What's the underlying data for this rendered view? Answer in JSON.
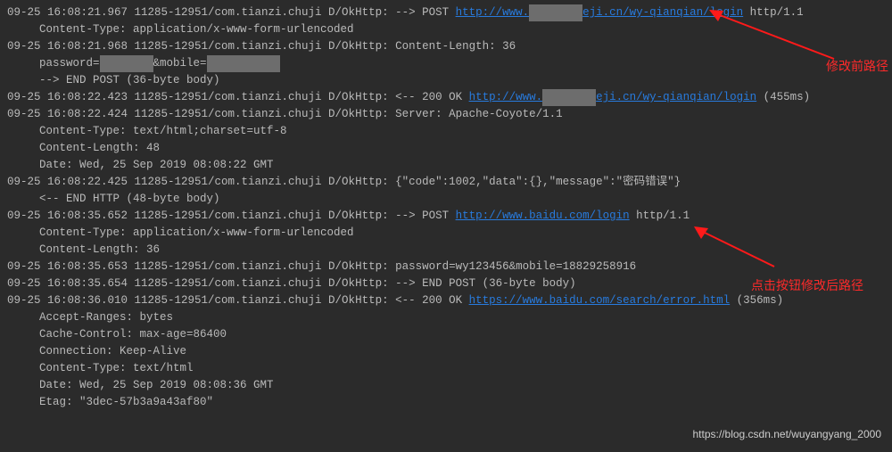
{
  "log": {
    "l1_ts": "09-25 16:08:21.967 11285-12951/com.tianzi.chuji D/OkHttp: --> POST ",
    "l1_url_a": "http://www.",
    "l1_url_mask": "________",
    "l1_url_b": "eji.cn/wy-qianqian/login",
    "l1_tail": " http/1.1",
    "l2": "Content-Type: application/x-www-form-urlencoded",
    "l3": "09-25 16:08:21.968 11285-12951/com.tianzi.chuji D/OkHttp: Content-Length: 36",
    "l4_a": "password=",
    "l4_mask1": "________",
    "l4_b": "&mobile=",
    "l4_mask2": "___________",
    "l5": "--> END POST (36-byte body)",
    "l6_ts": "09-25 16:08:22.423 11285-12951/com.tianzi.chuji D/OkHttp: <-- 200 OK ",
    "l6_url_a": "http://www.",
    "l6_mask": "________",
    "l6_url_b": "eji.cn/wy-qianqian/login",
    "l6_tail": " (455ms)",
    "l7": "09-25 16:08:22.424 11285-12951/com.tianzi.chuji D/OkHttp: Server: Apache-Coyote/1.1",
    "l8": "Content-Type: text/html;charset=utf-8",
    "l9": "Content-Length: 48",
    "l10": "Date: Wed, 25 Sep 2019 08:08:22 GMT",
    "l11": "09-25 16:08:22.425 11285-12951/com.tianzi.chuji D/OkHttp: {\"code\":1002,\"data\":{},\"message\":\"密码错误\"}",
    "l12": "<-- END HTTP (48-byte body)",
    "l13_ts": "09-25 16:08:35.652 11285-12951/com.tianzi.chuji D/OkHttp: --> POST ",
    "l13_url": "http://www.baidu.com/login",
    "l13_tail": " http/1.1",
    "l14": "Content-Type: application/x-www-form-urlencoded",
    "l15": "Content-Length: 36",
    "l16": "09-25 16:08:35.653 11285-12951/com.tianzi.chuji D/OkHttp: password=wy123456&mobile=18829258916",
    "l17": "09-25 16:08:35.654 11285-12951/com.tianzi.chuji D/OkHttp: --> END POST (36-byte body)",
    "l18_ts": "09-25 16:08:36.010 11285-12951/com.tianzi.chuji D/OkHttp: <-- 200 OK ",
    "l18_url": "https://www.baidu.com/search/error.html",
    "l18_tail": " (356ms)",
    "l19": "Accept-Ranges: bytes",
    "l20": "Cache-Control: max-age=86400",
    "l21": "Connection: Keep-Alive",
    "l22": "Content-Type: text/html",
    "l23": "Date: Wed, 25 Sep 2019 08:08:36 GMT",
    "l24": "Etag: \"3dec-57b3a9a43af80\""
  },
  "annot": {
    "top": "修改前路径",
    "bot": "点击按钮修改后路径"
  },
  "watermark": "https://blog.csdn.net/wuyangyang_2000"
}
